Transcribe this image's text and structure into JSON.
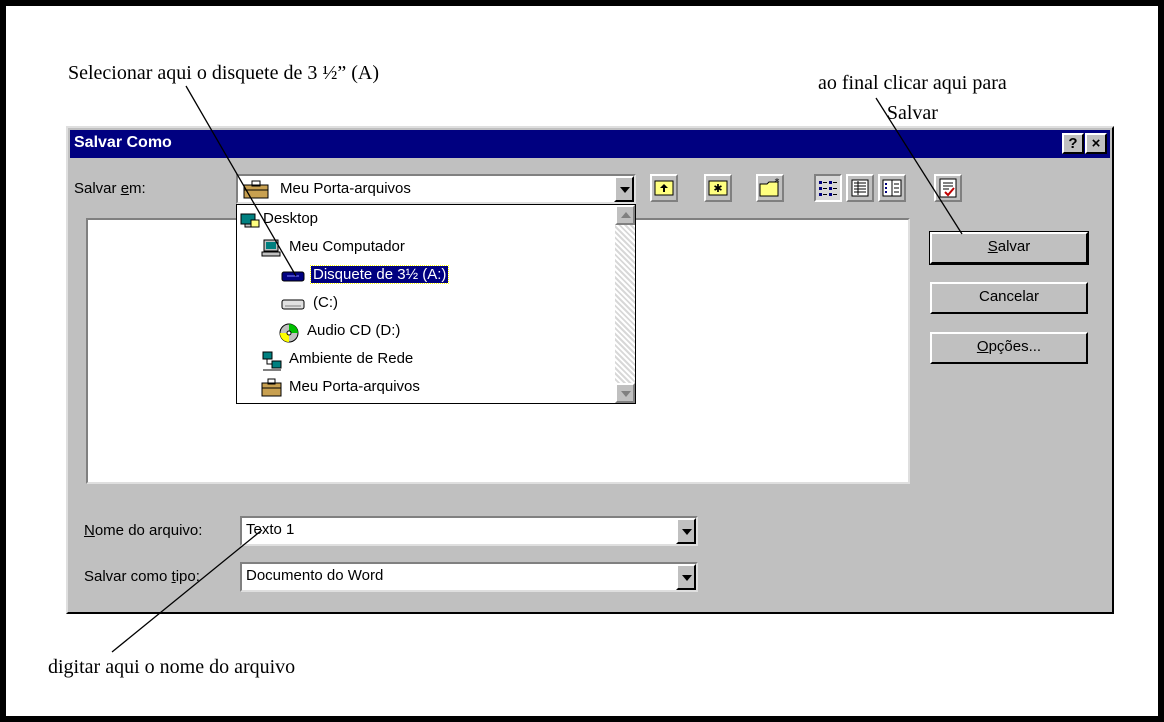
{
  "annotations": {
    "select_drive": "Selecionar aqui o disquete de 3 ½” (A)",
    "save_line1": "ao final clicar aqui para",
    "save_line2": "Salvar",
    "file_name": "digitar aqui o nome do arquivo"
  },
  "dialog": {
    "title": "Salvar Como",
    "help_label": "?",
    "close_label": "×",
    "save_in_label_pre": "Salvar ",
    "save_in_label_u": "e",
    "save_in_label_post": "m:",
    "save_in_value": "Meu Porta-arquivos",
    "dropdown_items": [
      {
        "label": "Desktop",
        "icon": "desktop-icon"
      },
      {
        "label": "Meu Computador",
        "icon": "computer-icon"
      },
      {
        "label": "Disquete de 3½ (A:)",
        "icon": "floppy-drive-icon",
        "selected": true
      },
      {
        "label": "(C:)",
        "icon": "hard-drive-icon"
      },
      {
        "label": "Audio CD (D:)",
        "icon": "cd-drive-icon"
      },
      {
        "label": "Ambiente de Rede",
        "icon": "network-icon"
      },
      {
        "label": "Meu Porta-arquivos",
        "icon": "briefcase-icon"
      }
    ],
    "toolbar_icons": [
      "up-one-level-icon",
      "desktop-shortcut-icon",
      "new-folder-icon",
      "list-view-icon",
      "details-view-icon",
      "properties-view-icon",
      "commands-settings-icon"
    ],
    "buttons": {
      "save_u": "S",
      "save_rest": "alvar",
      "cancel": "Cancelar",
      "options_u": "O",
      "options_rest": "pções..."
    },
    "file_name_label_u": "N",
    "file_name_label_rest": "ome do arquivo:",
    "file_name_value": "Texto 1",
    "file_type_label_pre": "Salvar como ",
    "file_type_label_u": "t",
    "file_type_label_post": "ipo:",
    "file_type_value": "Documento do Word"
  }
}
